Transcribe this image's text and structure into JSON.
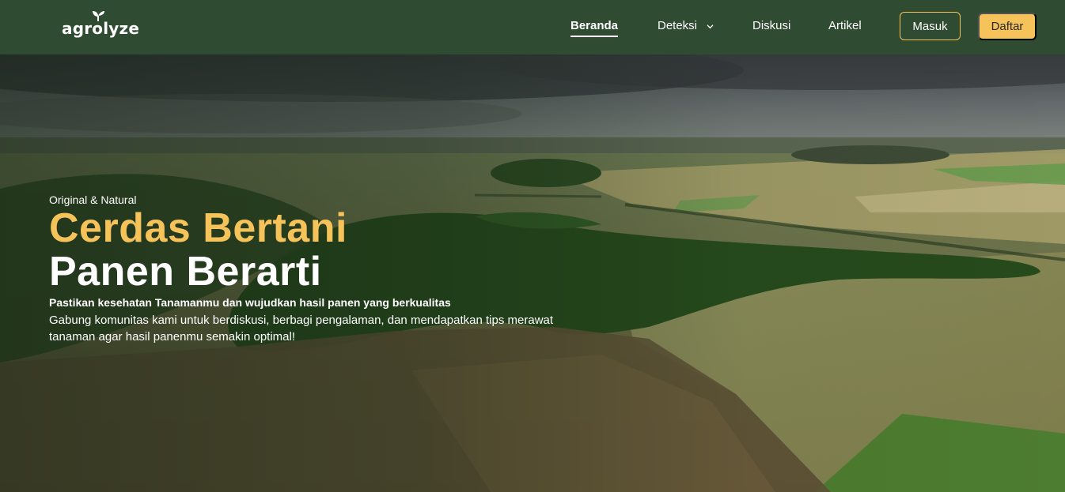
{
  "navbar": {
    "logo_text": "agrolyze",
    "links": [
      {
        "label": "Beranda",
        "active": true
      },
      {
        "label": "Deteksi",
        "has_dropdown": true
      },
      {
        "label": "Diskusi"
      },
      {
        "label": "Artikel"
      }
    ],
    "login_label": "Masuk",
    "register_label": "Daftar"
  },
  "hero": {
    "eyebrow": "Original & Natural",
    "title_line1": "Cerdas Bertani",
    "title_line2": "Panen Berarti",
    "subtitle": "Pastikan kesehatan Tanamanmu dan wujudkan hasil panen yang berkualitas",
    "description": "Gabung komunitas kami untuk berdiskusi, berbagi pengalaman, dan mendapatkan tips merawat tanaman agar hasil panenmu semakin optimal!"
  },
  "colors": {
    "nav_bg": "#2f4b31",
    "accent": "#f6c25a",
    "text_light": "#ffffff"
  },
  "icons": {
    "logo": "sprout-icon",
    "dropdown": "chevron-down-icon"
  }
}
